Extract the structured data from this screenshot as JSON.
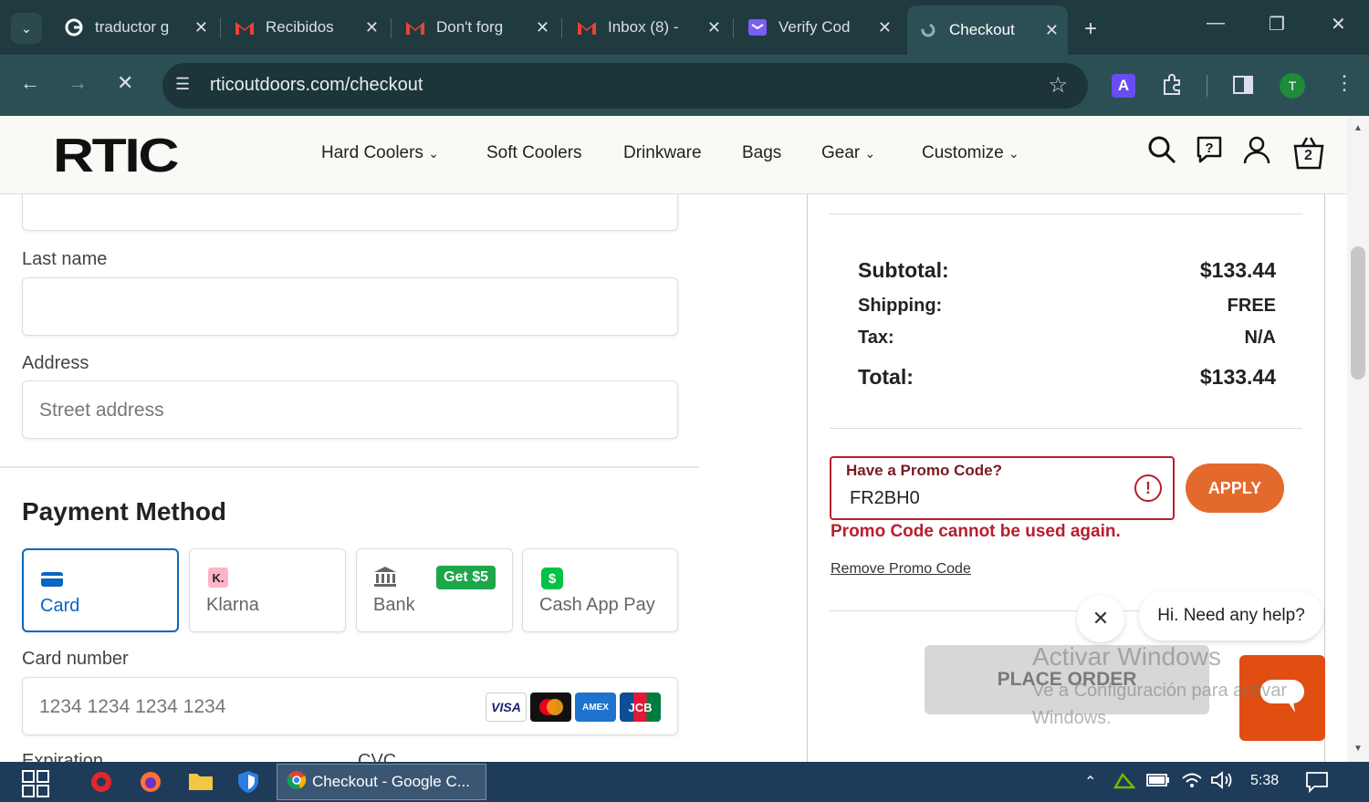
{
  "browser": {
    "tabs": [
      {
        "title": "traductor g",
        "icon": "google-icon"
      },
      {
        "title": "Recibidos",
        "icon": "gmail-icon"
      },
      {
        "title": "Don't forg",
        "icon": "gmail-icon"
      },
      {
        "title": "Inbox (8) -",
        "icon": "gmail-icon"
      },
      {
        "title": "Verify Cod",
        "icon": "mail-icon"
      },
      {
        "title": "Checkout",
        "icon": "loading-icon"
      }
    ],
    "url": "rticoutdoors.com/checkout",
    "profile_initial": "T",
    "extension_letter": "A"
  },
  "site": {
    "logo": "RTIC",
    "nav": [
      {
        "label": "Hard Coolers",
        "dropdown": true
      },
      {
        "label": "Soft Coolers",
        "dropdown": false
      },
      {
        "label": "Drinkware",
        "dropdown": false
      },
      {
        "label": "Bags",
        "dropdown": false
      },
      {
        "label": "Gear",
        "dropdown": true
      },
      {
        "label": "Customize",
        "dropdown": true
      }
    ],
    "cart_count": "2"
  },
  "form": {
    "last_name_label": "Last name",
    "address_label": "Address",
    "address_placeholder": "Street address",
    "payment_title": "Payment Method",
    "payment_methods": [
      {
        "label": "Card",
        "icon": "card-icon"
      },
      {
        "label": "Klarna",
        "icon": "klarna-icon",
        "icon_text": "K."
      },
      {
        "label": "Bank",
        "icon": "bank-icon",
        "badge": "Get $5"
      },
      {
        "label": "Cash App Pay",
        "icon": "cashapp-icon",
        "icon_text": "$"
      }
    ],
    "card_number_label": "Card number",
    "card_number_placeholder": "1234 1234 1234 1234",
    "card_brands": [
      "VISA",
      "mastercard-icon",
      "AMEX",
      "JCB"
    ],
    "expiration_label": "Expiration",
    "cvc_label": "CVC"
  },
  "summary": {
    "subtotal_label": "Subtotal:",
    "subtotal": "$133.44",
    "shipping_label": "Shipping:",
    "shipping": "FREE",
    "tax_label": "Tax:",
    "tax": "N/A",
    "total_label": "Total:",
    "total": "$133.44",
    "promo_label": "Have a Promo Code?",
    "promo_value": "FR2BH0",
    "apply_label": "APPLY",
    "promo_error": "Promo Code cannot be used again.",
    "remove_promo": "Remove Promo Code",
    "place_order": "PLACE ORDER"
  },
  "chat": {
    "greeting": "Hi. Need any help?"
  },
  "watermark": {
    "line1": "Activar Windows",
    "line2": "Ve a Configuración para activar",
    "line3": "Windows."
  },
  "taskbar": {
    "app_title": "Checkout - Google C...",
    "time": "5:38"
  }
}
